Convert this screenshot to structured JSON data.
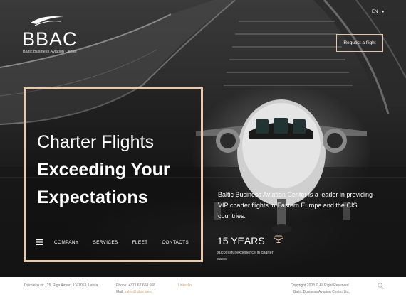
{
  "header": {
    "logo_text": "BBAC",
    "logo_subtitle": "Baltic Business Aviation Center",
    "language": "EN",
    "request_flight_label": "Request a flight"
  },
  "hero": {
    "headline_light": "Charter Flights",
    "headline_bold_1": "Exceeding Your",
    "headline_bold_2": "Expectations",
    "description": "Baltic Business Aviation Center is a leader in providing VIP charter flights in Eastern Europe and the CIS countries.",
    "years_title": "15 YEARS",
    "years_subtitle": "successful experience in charter sales"
  },
  "nav": {
    "items": [
      {
        "label": "COMPANY"
      },
      {
        "label": "SERVICES"
      },
      {
        "label": "FLEET"
      },
      {
        "label": "CONTACTS"
      }
    ]
  },
  "footer": {
    "address": "Dzirnieku str., 15, Riga Airport, LV-1053, Latvia",
    "phone": "Phone: +371 67 668 668",
    "mail_label": "Mail:",
    "mail_value": "sales@bbac.aero",
    "linkedin": "LinkedIn",
    "copyright_1": "Copyright 2003 © All Right Reserved",
    "copyright_2": "Baltic Business Aviation Center Ltd."
  },
  "colors": {
    "accent": "#e7c9ab",
    "link": "#c9a27a",
    "footer_bg": "#ffffff"
  },
  "icons": [
    "logo-swoosh-icon",
    "chevron-down-icon",
    "menu-icon",
    "trophy-icon",
    "search-icon"
  ]
}
